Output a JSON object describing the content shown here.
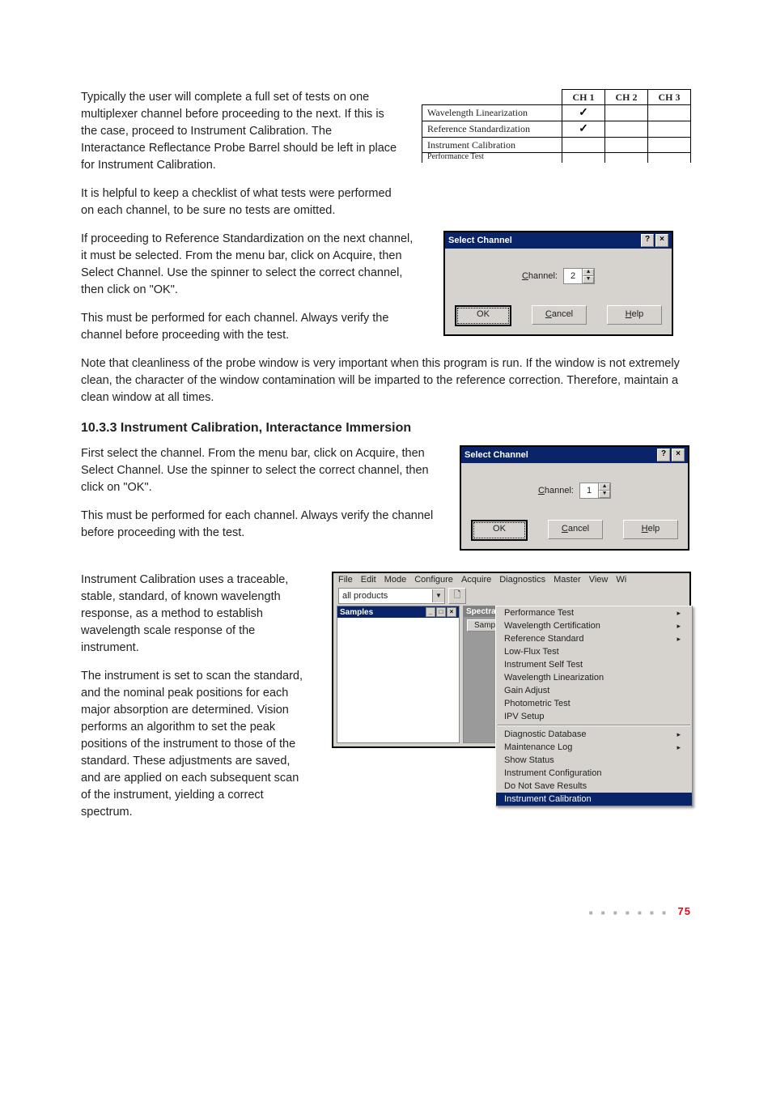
{
  "body": {
    "p1": "Typically the user will complete a full set of tests on one multiplexer channel before proceeding to the next. If this is the case, proceed to Instrument Calibration. The Interactance Reflectance Probe Barrel should be left in place for Instrument Calibration.",
    "p2": "It is helpful to keep a checklist of what tests were performed on each channel, to be sure no tests are omitted.",
    "p3": "If proceeding to Reference Standardization on the next channel, it must be selected. From the menu bar, click on Acquire, then Select Channel. Use the spinner to select the correct channel, then click on \"OK\".",
    "p4": "This must be performed for each channel. Always verify the channel before proceeding with the test.",
    "p5": "Note that cleanliness of the probe window is very important when this program is run. If the window is not extremely clean, the character of the window contamination will be imparted to the reference correction. Therefore, maintain a clean window at all times.",
    "heading": "10.3.3   Instrument Calibration, Interactance Immersion",
    "p6": "First select the channel. From the menu bar, click on Acquire, then Select Channel. Use the spinner to select the correct channel, then click on \"OK\".",
    "p7": "This must be performed for each channel. Always verify the channel before proceeding with the test.",
    "p8": "Instrument Calibration uses a traceable, stable, standard, of known wavelength response, as a method to establish wavelength scale response of the instrument.",
    "p9": "The instrument is set to scan the standard, and the nominal peak positions for each major absorption are determined. Vision performs an algorithm to set the peak positions of the instrument to those of the standard. These adjustments are saved, and are applied on each subsequent scan of the instrument, yielding a correct spectrum."
  },
  "checklist": {
    "headers": [
      "CH 1",
      "CH 2",
      "CH 3"
    ],
    "rows": [
      {
        "label": "Wavelength Linearization",
        "ch1": "✓",
        "ch2": "",
        "ch3": ""
      },
      {
        "label": "Reference Standardization",
        "ch1": "✓",
        "ch2": "",
        "ch3": ""
      },
      {
        "label": "Instrument Calibration",
        "ch1": "",
        "ch2": "",
        "ch3": ""
      },
      {
        "label": "Performance Test",
        "ch1": "",
        "ch2": "",
        "ch3": ""
      }
    ]
  },
  "dialog1": {
    "title": "Select Channel",
    "label_pre": "C",
    "label_post": "hannel:",
    "value": "2",
    "ok": "OK",
    "cancel_pre": "C",
    "cancel_post": "ancel",
    "help_pre": "H",
    "help_post": "elp"
  },
  "dialog2": {
    "title": "Select Channel",
    "label_pre": "C",
    "label_post": "hannel:",
    "value": "1",
    "ok": "OK",
    "cancel_pre": "C",
    "cancel_post": "ancel",
    "help_pre": "H",
    "help_post": "elp"
  },
  "appwin": {
    "menus": [
      "File",
      "Edit",
      "Mode",
      "Configure",
      "Acquire",
      "Diagnostics",
      "Master",
      "View",
      "Wi"
    ],
    "combo": "all products",
    "panel_left": "Samples",
    "panel_right": "Spectra",
    "panel_tab": "Sample",
    "dropdown_top": [
      {
        "t": "Performance Test",
        "sub": true
      },
      {
        "t": "Wavelength Certification",
        "sub": true
      },
      {
        "t": "Reference Standard",
        "sub": true
      },
      {
        "t": "Low-Flux Test",
        "sub": false
      },
      {
        "t": "Instrument Self Test",
        "sub": false
      },
      {
        "t": "Wavelength Linearization",
        "sub": false
      },
      {
        "t": "Gain Adjust",
        "sub": false
      },
      {
        "t": "Photometric Test",
        "sub": false
      },
      {
        "t": "IPV Setup",
        "sub": false
      }
    ],
    "dropdown_bottom": [
      {
        "t": "Diagnostic Database",
        "sub": true
      },
      {
        "t": "Maintenance Log",
        "sub": true
      },
      {
        "t": "Show Status",
        "sub": false
      },
      {
        "t": "Instrument Configuration",
        "sub": false
      },
      {
        "t": "Do Not Save Results",
        "sub": false
      },
      {
        "t": "Instrument Calibration",
        "sub": false,
        "sel": true
      }
    ]
  },
  "footer": {
    "page": "75"
  }
}
